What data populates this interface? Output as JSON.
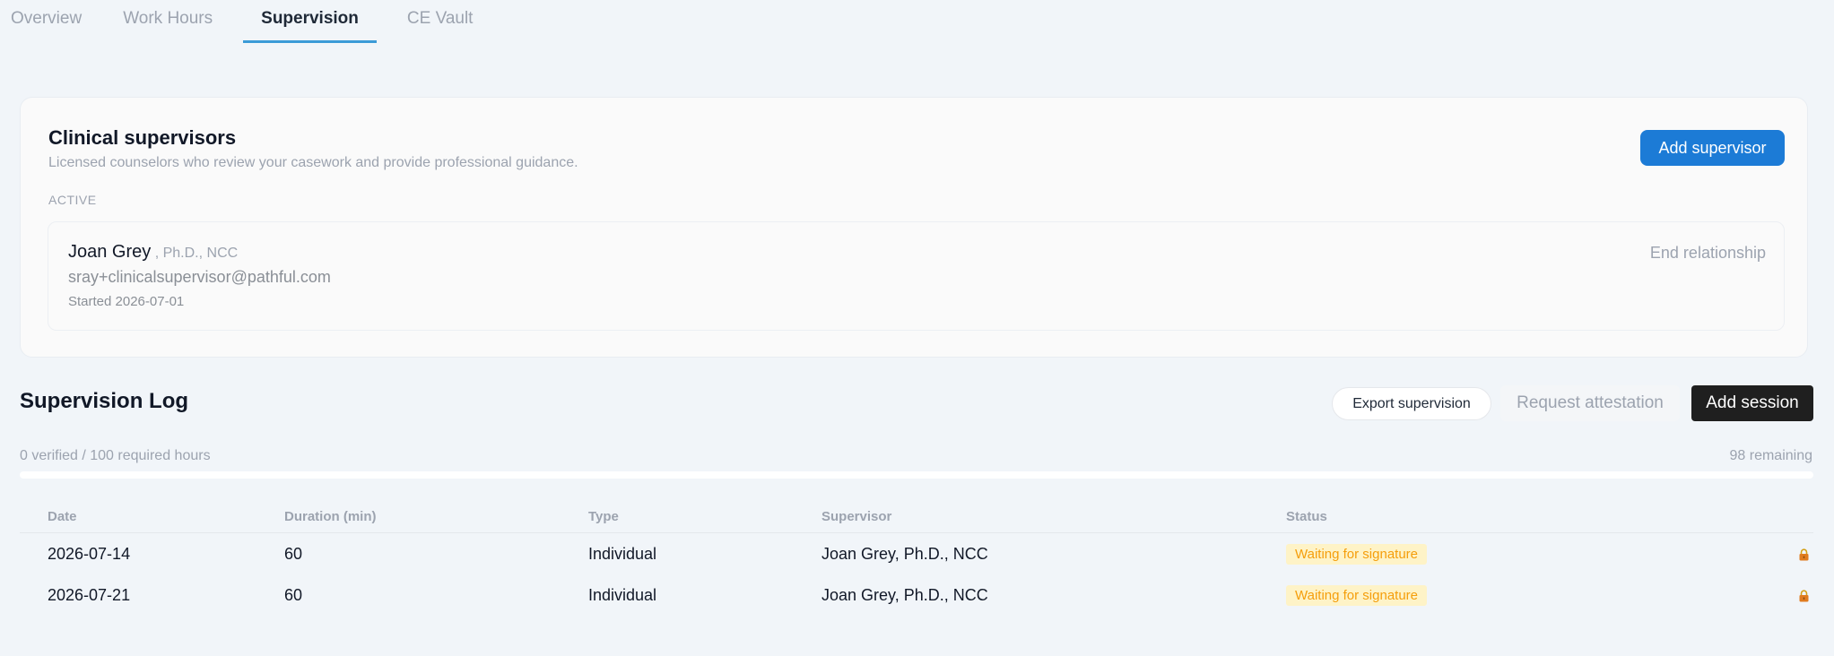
{
  "tabs": [
    {
      "label": "Overview"
    },
    {
      "label": "Work Hours"
    },
    {
      "label": "Supervision",
      "active": true
    },
    {
      "label": "CE Vault"
    }
  ],
  "supervisors_card": {
    "title": "Clinical supervisors",
    "description": "Licensed counselors who review your casework and provide professional guidance.",
    "add_button_label": "Add supervisor",
    "section_label": "ACTIVE",
    "supervisor": {
      "name": "Joan Grey",
      "credentials": ", Ph.D., NCC",
      "email": "sray+clinicalsupervisor@pathful.com",
      "started": "Started 2026-07-01",
      "end_action": "End relationship"
    }
  },
  "log": {
    "title": "Supervision Log",
    "export_label": "Export supervision",
    "attest_label": "Request attestation",
    "add_session_label": "Add session",
    "progress_text": "0 verified / 100 required hours",
    "remaining_text": "98 remaining",
    "progress_fraction": 0,
    "columns": {
      "date": "Date",
      "duration": "Duration (min)",
      "type": "Type",
      "supervisor": "Supervisor",
      "status": "Status"
    },
    "rows": [
      {
        "date": "2026-07-14",
        "duration": "60",
        "type": "Individual",
        "supervisor": "Joan Grey, Ph.D., NCC",
        "status": "Waiting for signature",
        "icon": "lock-icon"
      },
      {
        "date": "2026-07-21",
        "duration": "60",
        "type": "Individual",
        "supervisor": "Joan Grey, Ph.D., NCC",
        "status": "Waiting for signature",
        "icon": "lock-icon"
      }
    ]
  },
  "colors": {
    "accent": "#1c7bd6",
    "tab_underline": "#3b9bd7",
    "badge_bg": "#fef3c7",
    "badge_text": "#f59e0b",
    "dark_button": "#1f1f1f"
  }
}
